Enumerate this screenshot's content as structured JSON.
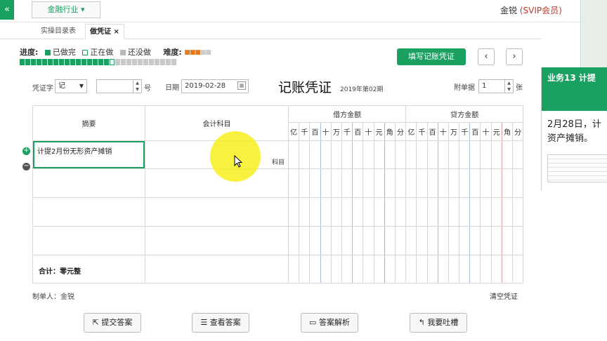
{
  "topbar": {
    "collapse_icon": "«",
    "industry_label": "金融行业",
    "industry_caret": "▾",
    "user_name": "金锐",
    "user_badge": "(SVIP会员)"
  },
  "tabs": [
    {
      "label": "实操目录表"
    },
    {
      "label": "做凭证",
      "close": "×"
    }
  ],
  "progress": {
    "label": "进度:",
    "legend_done": "已做完",
    "legend_doing": "正在做",
    "legend_todo": "还没做",
    "difficulty_label": "难度:",
    "difficulty_stars_filled": 3,
    "difficulty_stars_total": 5,
    "segments_done": 16,
    "segments_doing": 1,
    "segments_todo": 11
  },
  "toolbar": {
    "fill_voucher": "填写记账凭证",
    "prev": "‹",
    "next": "›"
  },
  "voucher": {
    "word_label": "凭证字",
    "word_value": "记",
    "number_value": "",
    "number_suffix": "号",
    "date_label": "日期",
    "date_value": "2019-02-28",
    "title": "记账凭证",
    "period": "2019年第02期",
    "attach_label": "附单据",
    "attach_value": "1",
    "attach_suffix": "张",
    "col_summary": "摘要",
    "col_subject": "会计科目",
    "col_debit": "借方金额",
    "col_credit": "贷方金额",
    "digits": [
      "亿",
      "千",
      "百",
      "十",
      "万",
      "千",
      "百",
      "十",
      "元",
      "角",
      "分"
    ],
    "row1_summary": "计提2月份无形资产摊销",
    "row1_subject_hint": "科目",
    "total_label": "合计：零元整",
    "maker": "制单人：金锐",
    "clear": "清空凭证"
  },
  "bottom": {
    "submit": "提交答案",
    "view": "查看答案",
    "analysis": "答案解析",
    "feedback": "我要吐槽"
  },
  "side_panel": {
    "title": "业务13 计提",
    "text_line1": "2月28日，计",
    "text_line2": "资产摊销。"
  }
}
